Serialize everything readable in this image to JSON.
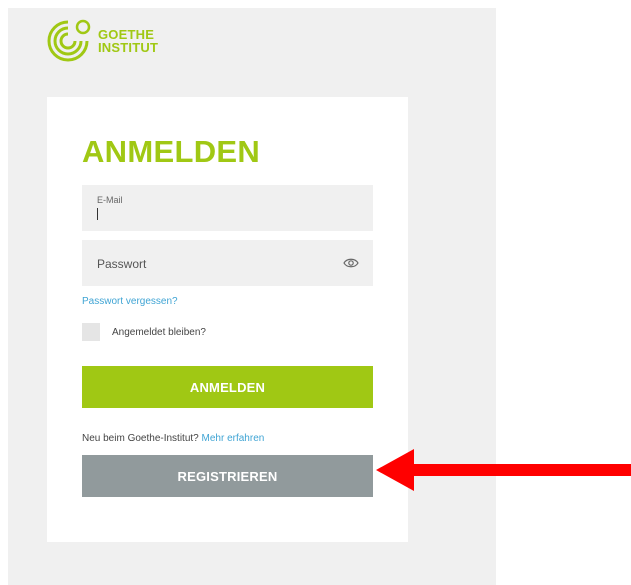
{
  "logo": {
    "line1": "GOETHE",
    "line2": "INSTITUT"
  },
  "form": {
    "title": "ANMELDEN",
    "email_label": "E-Mail",
    "password_placeholder": "Passwort",
    "forgot_link": "Passwort vergessen?",
    "remember_label": "Angemeldet bleiben?",
    "login_button": "ANMELDEN",
    "new_user_text": "Neu beim Goethe-Institut?",
    "more_link": "Mehr erfahren",
    "register_button": "REGISTRIEREN"
  },
  "colors": {
    "brand_green": "#a0c814",
    "link_blue": "#3fa4d4",
    "register_gray": "#919a9c",
    "annotation_red": "#ff0000"
  },
  "icons": {
    "password_toggle": "eye-icon",
    "annotation": "red-arrow-icon"
  }
}
